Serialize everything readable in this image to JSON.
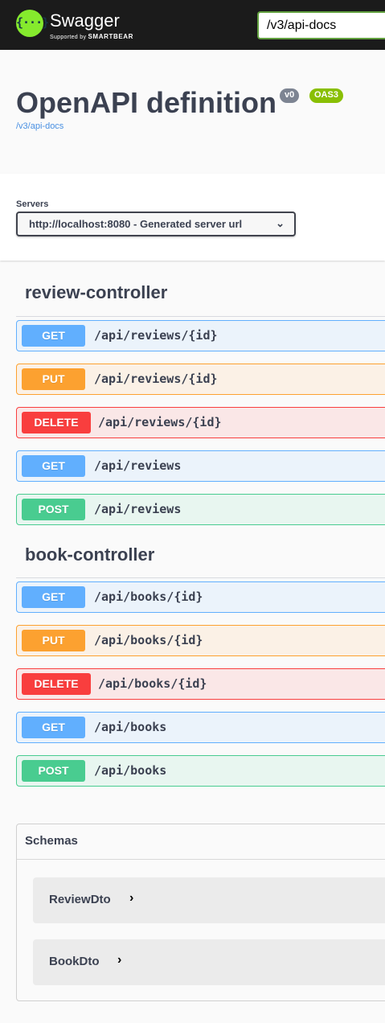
{
  "topbar": {
    "logo_icon_text": "{···}",
    "brand": "Swagger",
    "tagline_prefix": "Supported by",
    "tagline_company": "SMARTBEAR",
    "url_value": "/v3/api-docs"
  },
  "info": {
    "title": "OpenAPI definition",
    "version_badge": "v0",
    "oas_badge": "OAS3",
    "spec_link": "/v3/api-docs"
  },
  "servers": {
    "label": "Servers",
    "selected": "http://localhost:8080 - Generated server url"
  },
  "tags": [
    {
      "name": "review-controller",
      "operations": [
        {
          "method": "GET",
          "path": "/api/reviews/{id}"
        },
        {
          "method": "PUT",
          "path": "/api/reviews/{id}"
        },
        {
          "method": "DELETE",
          "path": "/api/reviews/{id}"
        },
        {
          "method": "GET",
          "path": "/api/reviews"
        },
        {
          "method": "POST",
          "path": "/api/reviews"
        }
      ]
    },
    {
      "name": "book-controller",
      "operations": [
        {
          "method": "GET",
          "path": "/api/books/{id}"
        },
        {
          "method": "PUT",
          "path": "/api/books/{id}"
        },
        {
          "method": "DELETE",
          "path": "/api/books/{id}"
        },
        {
          "method": "GET",
          "path": "/api/books"
        },
        {
          "method": "POST",
          "path": "/api/books"
        }
      ]
    }
  ],
  "schemas": {
    "title": "Schemas",
    "models": [
      {
        "name": "ReviewDto"
      },
      {
        "name": "BookDto"
      }
    ]
  },
  "colors": {
    "get": "#61affe",
    "put": "#fca130",
    "delete": "#f93e3e",
    "post": "#49cc90",
    "brand": "#85ea2d"
  }
}
